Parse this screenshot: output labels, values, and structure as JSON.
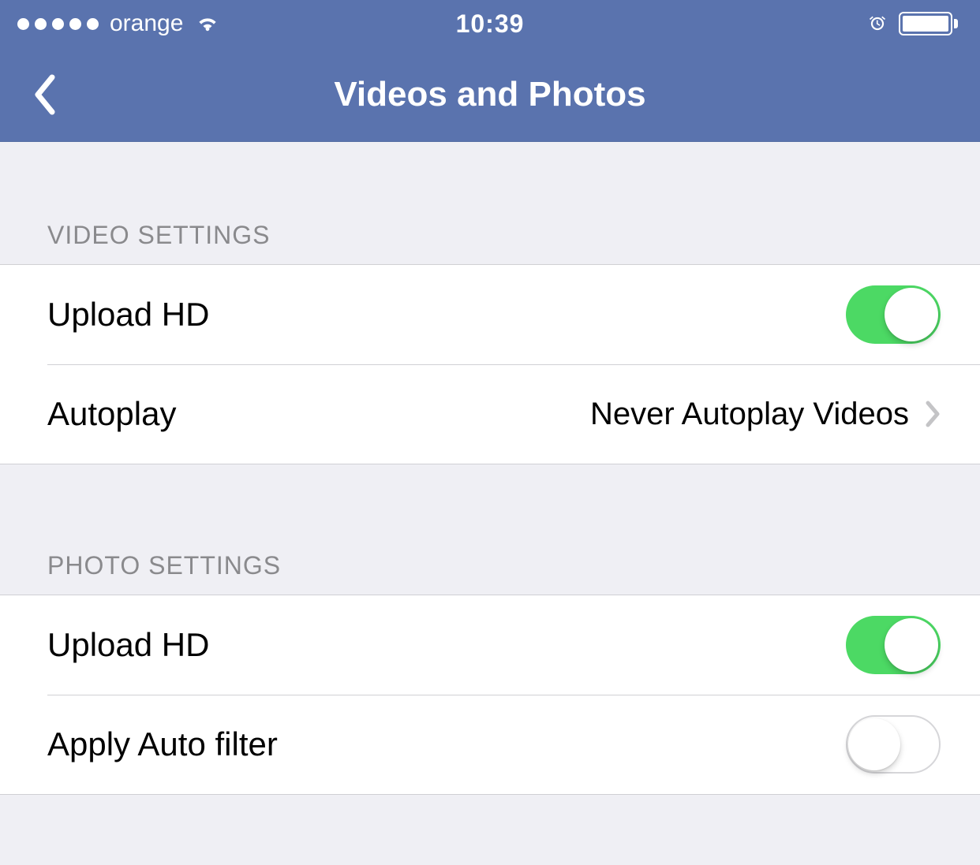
{
  "status_bar": {
    "carrier": "orange",
    "time": "10:39"
  },
  "header": {
    "title": "Videos and Photos"
  },
  "sections": {
    "video": {
      "header": "VIDEO SETTINGS",
      "upload_hd_label": "Upload HD",
      "upload_hd_on": true,
      "autoplay_label": "Autoplay",
      "autoplay_value": "Never Autoplay Videos"
    },
    "photo": {
      "header": "PHOTO SETTINGS",
      "upload_hd_label": "Upload HD",
      "upload_hd_on": true,
      "auto_filter_label": "Apply Auto filter",
      "auto_filter_on": false
    }
  }
}
